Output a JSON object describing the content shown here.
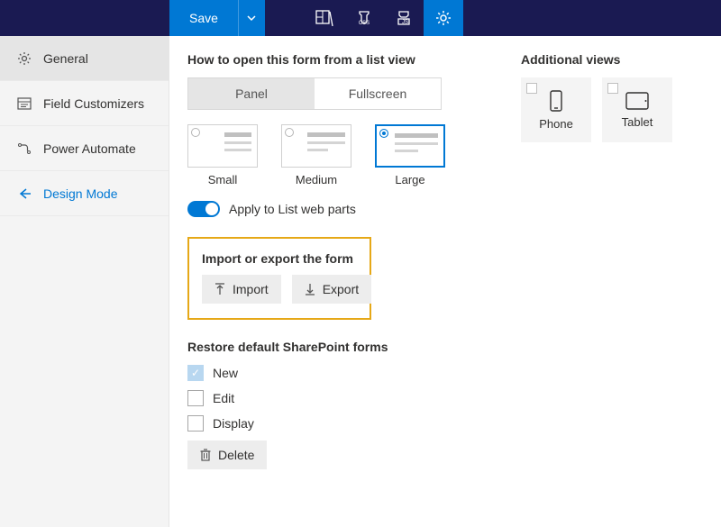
{
  "toolbar": {
    "save_label": "Save"
  },
  "sidebar": {
    "general": "General",
    "field_customizers": "Field Customizers",
    "power_automate": "Power Automate",
    "design_mode": "Design Mode"
  },
  "open_form": {
    "title": "How to open this form from a list view",
    "panel": "Panel",
    "fullscreen": "Fullscreen",
    "sizes": {
      "small": "Small",
      "medium": "Medium",
      "large": "Large"
    },
    "apply_label": "Apply to List web parts"
  },
  "import_export": {
    "title": "Import or export the form",
    "import_label": "Import",
    "export_label": "Export"
  },
  "restore": {
    "title": "Restore default SharePoint forms",
    "new_label": "New",
    "edit_label": "Edit",
    "display_label": "Display",
    "delete_label": "Delete"
  },
  "views": {
    "title": "Additional views",
    "phone": "Phone",
    "tablet": "Tablet"
  }
}
